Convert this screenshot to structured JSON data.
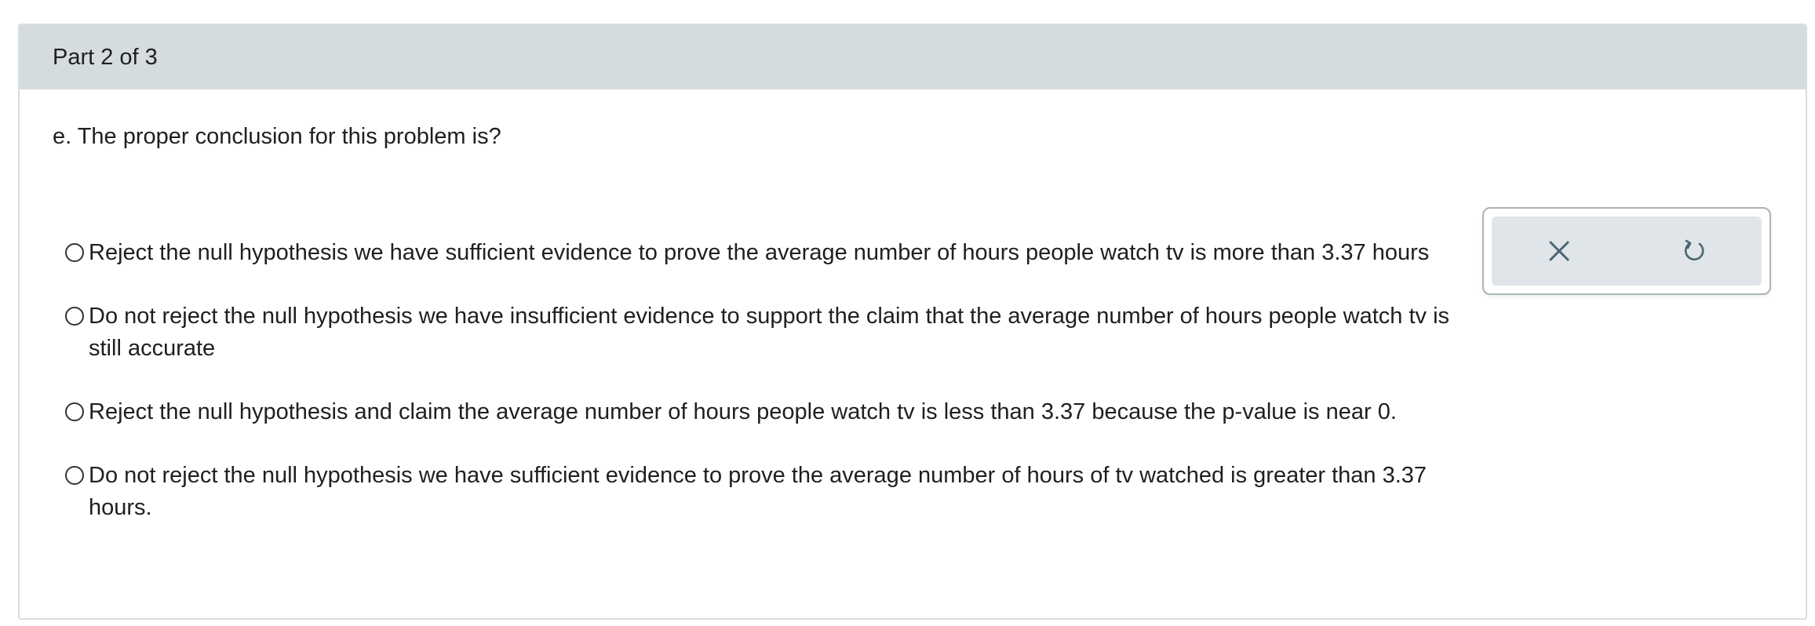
{
  "header": {
    "title": "Part 2 of 3"
  },
  "question": {
    "prompt": "e. The proper conclusion for this problem is?"
  },
  "choices": [
    {
      "label": "Reject the null hypothesis we have sufficient evidence to prove the average number of hours people watch tv is more than 3.37 hours"
    },
    {
      "label": "Do not reject the null hypothesis we have insufficient evidence to support the claim that the average number of hours people watch tv is still accurate"
    },
    {
      "label": "Reject the null hypothesis and claim the average number of hours people watch tv is less than 3.37 because the p-value is near 0."
    },
    {
      "label": "Do not reject the null hypothesis we have sufficient evidence to prove the average number of hours of tv watched is greater than 3.37 hours."
    }
  ],
  "tools": {
    "clear_icon": "close-icon",
    "undo_icon": "undo-icon",
    "icon_color": "#4a6572"
  }
}
